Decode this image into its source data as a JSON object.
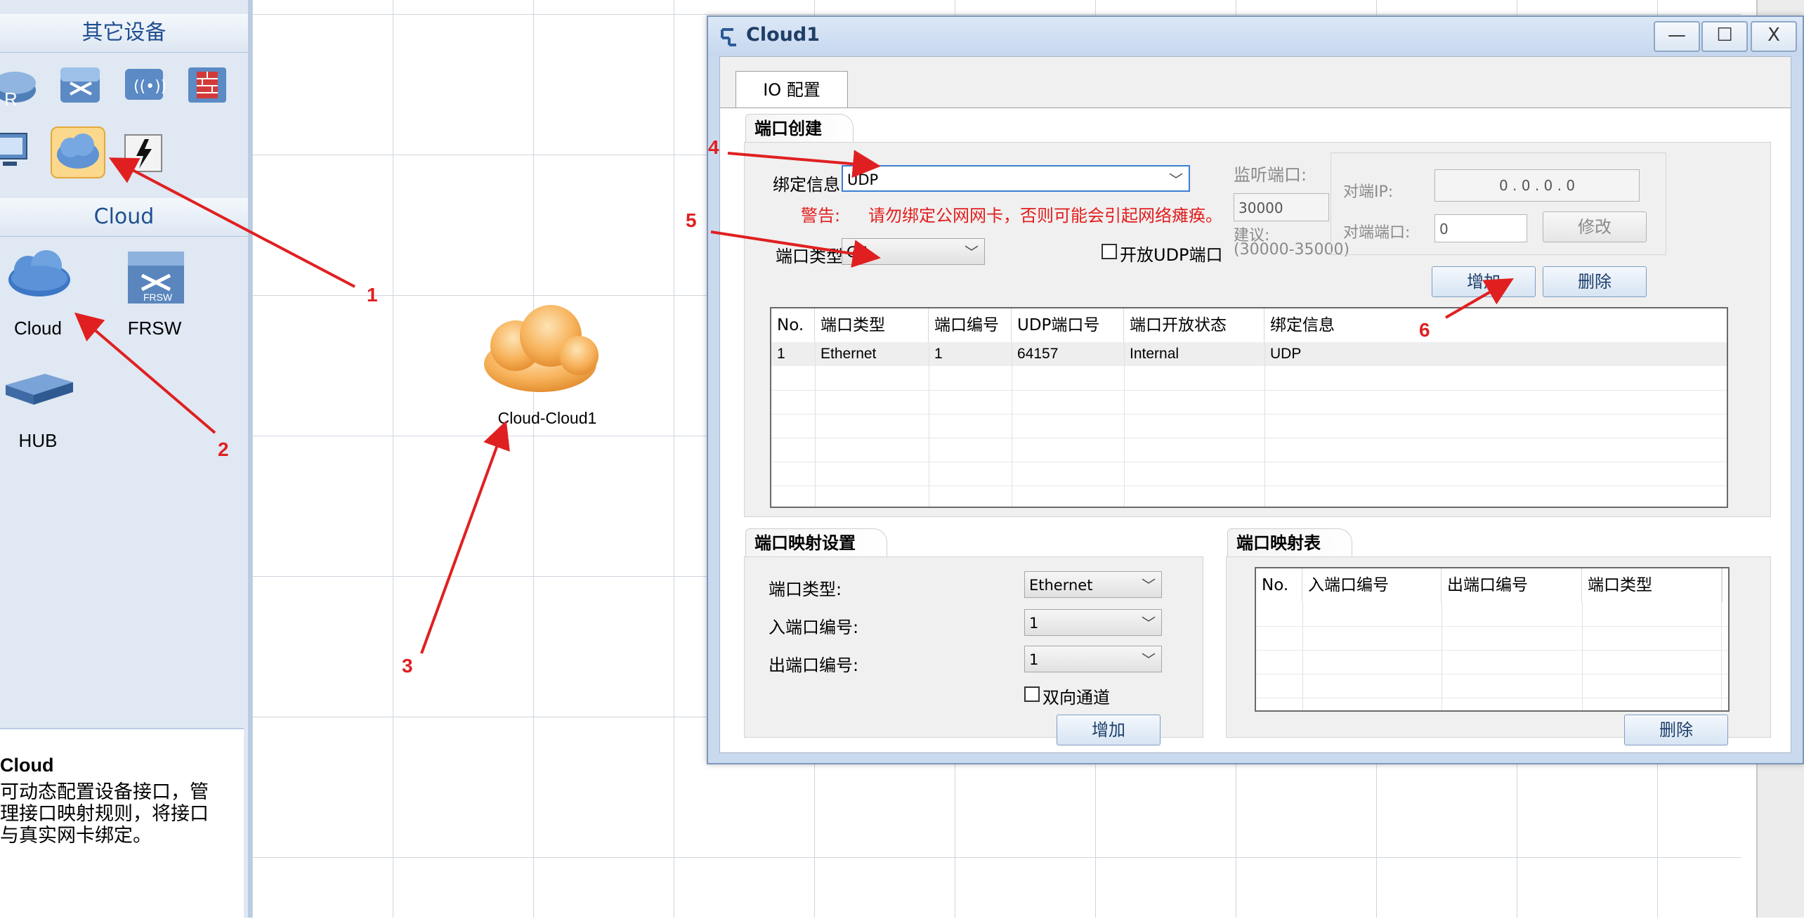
{
  "left_panel": {
    "other_devices_title": "其它设备",
    "cloud_section_title": "Cloud",
    "devices": [
      {
        "label": "Cloud",
        "icon": "cloud-icon"
      },
      {
        "label": "FRSW",
        "icon": "frsw-icon"
      },
      {
        "label": "HUB",
        "icon": "hub-icon"
      }
    ],
    "frsw_icon_text": "FRSW",
    "router_icon_text": "R",
    "info": {
      "title": "Cloud",
      "description": "可动态配置设备接口，管理接口映射规则，将接口与真实网卡绑定。"
    }
  },
  "canvas": {
    "node_label": "Cloud-Cloud1"
  },
  "dialog": {
    "title": "Cloud1",
    "controls": {
      "minimize": "—",
      "maximize": "☐",
      "close": "X"
    },
    "tab": "IO 配置",
    "port_create": {
      "section": "端口创建",
      "bind_label": "绑定信息:",
      "bind_value": "UDP",
      "warning_label": "警告:",
      "warning_text": "请勿绑定公网网卡，否则可能会引起网络瘫痪。",
      "port_type_label": "端口类型:",
      "port_type_value": "GE",
      "open_udp_label": "开放UDP端口",
      "listen_port_label": "监听端口:",
      "listen_port_value": "30000",
      "suggest_label": "建议:",
      "suggest_range": "(30000-35000)",
      "peer_ip_label": "对端IP:",
      "peer_ip_value": "0 . 0 . 0 . 0",
      "peer_port_label": "对端端口:",
      "peer_port_value": "0",
      "modify_button": "修改",
      "add_button": "增加",
      "delete_button": "删除",
      "table": {
        "headers": [
          "No.",
          "端口类型",
          "端口编号",
          "UDP端口号",
          "端口开放状态",
          "绑定信息"
        ],
        "rows": [
          [
            "1",
            "Ethernet",
            "1",
            "64157",
            "Internal",
            "UDP"
          ]
        ]
      }
    },
    "port_mapping_settings": {
      "section": "端口映射设置",
      "port_type_label": "端口类型:",
      "port_type_value": "Ethernet",
      "in_port_label": "入端口编号:",
      "in_port_value": "1",
      "out_port_label": "出端口编号:",
      "out_port_value": "1",
      "bidirectional_label": "双向通道",
      "add_button": "增加"
    },
    "port_mapping_table": {
      "section": "端口映射表",
      "headers": [
        "No.",
        "入端口编号",
        "出端口编号",
        "端口类型"
      ],
      "delete_button": "删除"
    }
  },
  "annotations": [
    "1",
    "2",
    "3",
    "4",
    "5",
    "6"
  ],
  "colors": {
    "annotation_red": "#e02020",
    "title_blue": "#1f4f8f",
    "cloud_orange": "#f7a94a"
  }
}
